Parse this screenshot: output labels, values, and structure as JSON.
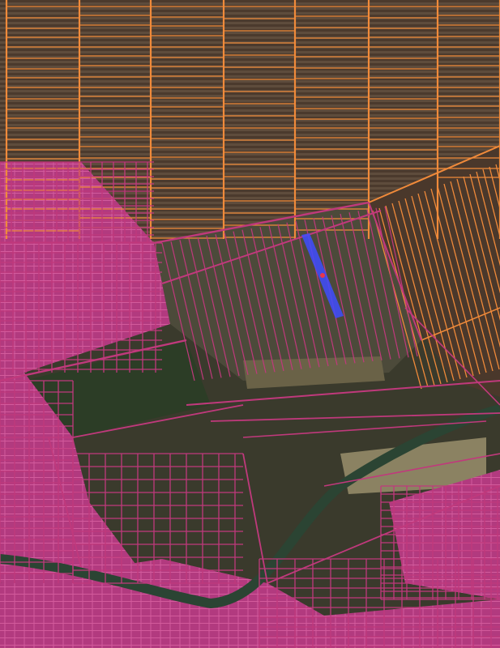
{
  "map": {
    "type": "cadastral-parcels-over-satellite",
    "layers": [
      {
        "name": "agricultural-parcels",
        "color": "#f08a3a"
      },
      {
        "name": "urban-parcels",
        "color": "#c0397c"
      },
      {
        "name": "selected-parcel",
        "color": "#3f4cff"
      },
      {
        "name": "river",
        "color": "#2f4a38"
      }
    ],
    "colors": {
      "field_dark": "#4a3a2c",
      "field_light": "#7d6a55",
      "vegetation": "#2f4328",
      "urban_fill": "#b93b82"
    },
    "selected_marker_icon": "map-pin-icon"
  }
}
